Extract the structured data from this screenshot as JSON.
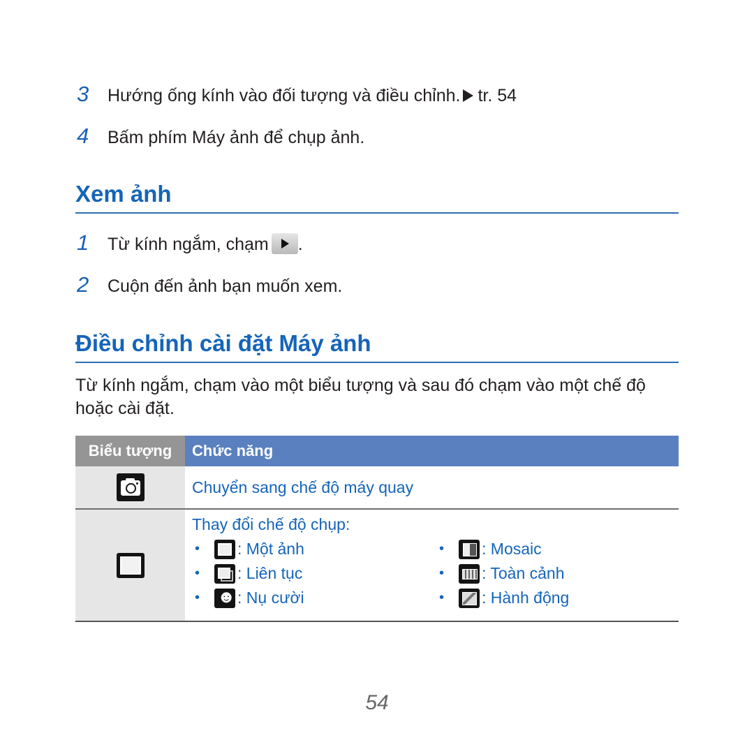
{
  "steps_top": [
    {
      "num": "3",
      "text": "Hướng ống kính vào đối tượng và điều chỉnh.",
      "ref": "tr. 54"
    },
    {
      "num": "4",
      "text": "Bấm phím Máy ảnh để chụp ảnh."
    }
  ],
  "section_view": {
    "title": "Xem ảnh",
    "steps": [
      {
        "num": "1",
        "text": "Từ kính ngắm, chạm",
        "suffix": ".",
        "icon": "play-icon"
      },
      {
        "num": "2",
        "text": "Cuộn đến ảnh bạn muốn xem."
      }
    ]
  },
  "section_settings": {
    "title": "Điều chỉnh cài đặt Máy ảnh",
    "intro": "Từ kính ngắm, chạm vào một biểu tượng và sau đó chạm vào một chế độ hoặc cài đặt."
  },
  "table": {
    "headers": [
      "Biểu tượng",
      "Chức năng"
    ],
    "rows": [
      {
        "icon": "camera-icon",
        "function": "Chuyển sang chế độ máy quay"
      },
      {
        "icon": "single-shot-icon",
        "function": "Thay đổi chế độ chụp:",
        "modes": [
          {
            "icon": "single-shot-icon",
            "label": ": Một ảnh"
          },
          {
            "icon": "mosaic-icon",
            "label": ": Mosaic"
          },
          {
            "icon": "continuous-icon",
            "label": ": Liên tục"
          },
          {
            "icon": "panorama-icon",
            "label": ": Toàn cảnh"
          },
          {
            "icon": "smile-icon",
            "label": ": Nụ cười"
          },
          {
            "icon": "action-icon",
            "label": ": Hành động"
          }
        ]
      }
    ]
  },
  "colors": {
    "heading": "#1565b8",
    "header_gray": "#959595",
    "header_blue": "#5a80bf",
    "icon_col_bg": "#e6e6e6"
  },
  "page_number": "54"
}
